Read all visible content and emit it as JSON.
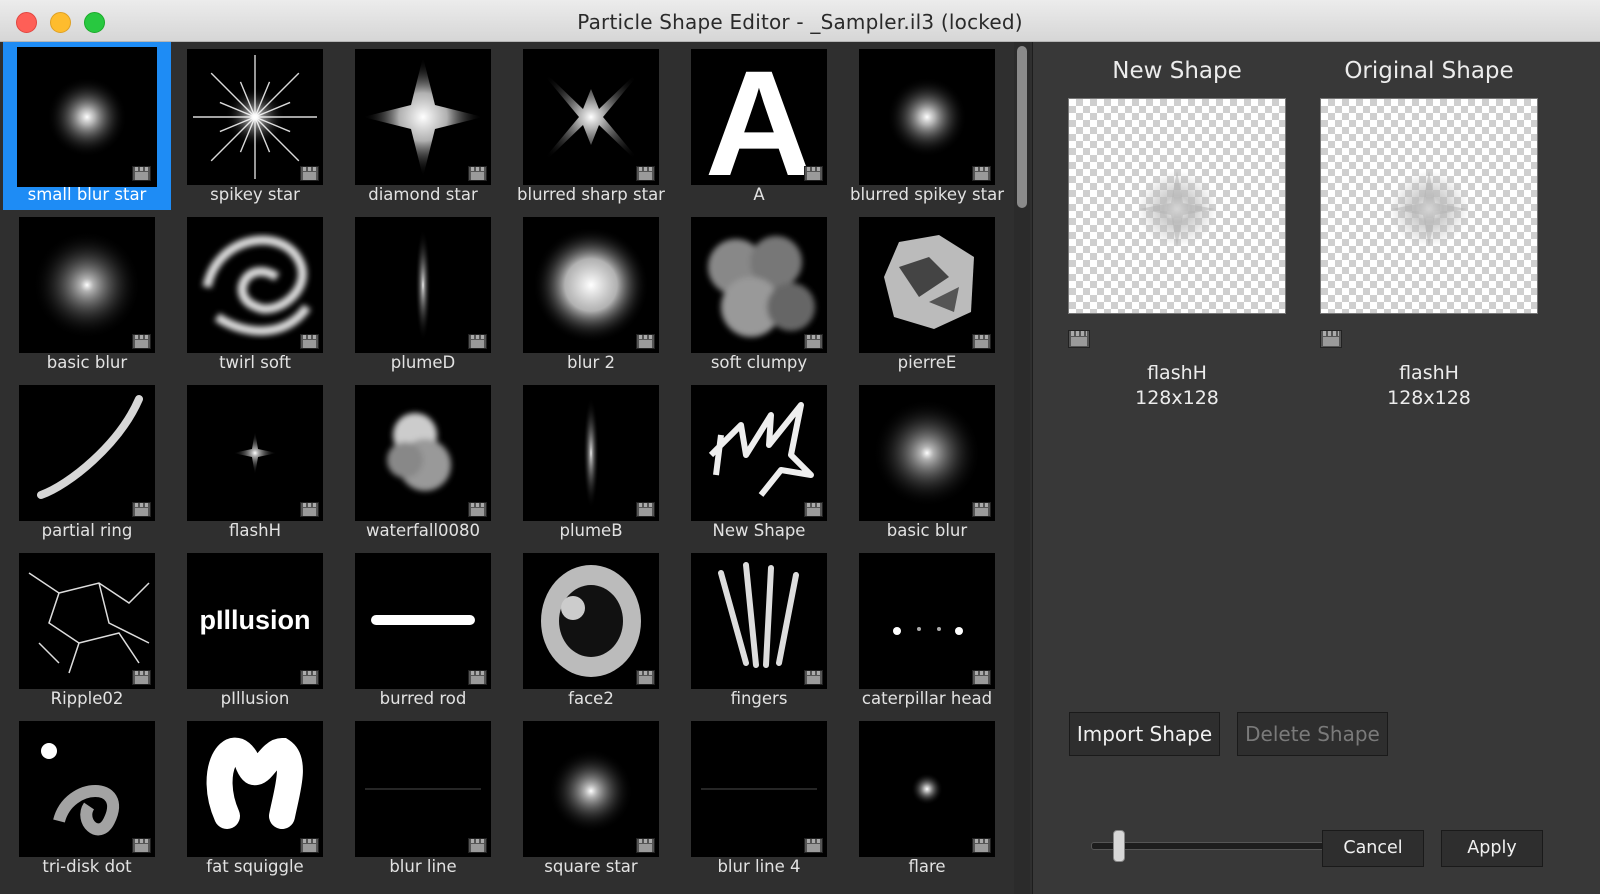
{
  "window": {
    "title": "Particle Shape Editor - _Sampler.il3 (locked)"
  },
  "shapes": [
    {
      "name": "small blur star",
      "art": "star-small"
    },
    {
      "name": "spikey star",
      "art": "star-spikey"
    },
    {
      "name": "diamond star",
      "art": "star-diamond"
    },
    {
      "name": "blurred sharp star",
      "art": "star-sharp"
    },
    {
      "name": "A",
      "art": "letter-a"
    },
    {
      "name": "blurred spikey star",
      "art": "star-small"
    },
    {
      "name": "basic blur",
      "art": "blur"
    },
    {
      "name": "twirl soft",
      "art": "twirl"
    },
    {
      "name": "plumeD",
      "art": "plume"
    },
    {
      "name": "blur 2",
      "art": "blur-big"
    },
    {
      "name": "soft clumpy",
      "art": "clumpy"
    },
    {
      "name": "pierreE",
      "art": "rock"
    },
    {
      "name": "partial ring",
      "art": "ring"
    },
    {
      "name": "flashH",
      "art": "flash"
    },
    {
      "name": "waterfall0080",
      "art": "cloud"
    },
    {
      "name": "plumeB",
      "art": "plume"
    },
    {
      "name": "New Shape",
      "art": "lightning"
    },
    {
      "name": "basic blur",
      "art": "blur"
    },
    {
      "name": "Ripple02",
      "art": "cracks"
    },
    {
      "name": "pIllusion",
      "art": "word"
    },
    {
      "name": "burred rod",
      "art": "rod"
    },
    {
      "name": "face2",
      "art": "face"
    },
    {
      "name": "fingers",
      "art": "fingers"
    },
    {
      "name": "caterpillar head",
      "art": "dots"
    },
    {
      "name": "tri-disk dot",
      "art": "swirl"
    },
    {
      "name": "fat squiggle",
      "art": "squiggle"
    },
    {
      "name": "blur line",
      "art": "line"
    },
    {
      "name": "square star",
      "art": "blur-square"
    },
    {
      "name": "blur line 4",
      "art": "line"
    },
    {
      "name": "flare",
      "art": "flare"
    }
  ],
  "thumb_text": {
    "letter": "A",
    "word": "pIllusion"
  },
  "selected_index": 0,
  "preview": {
    "new": {
      "title": "New Shape",
      "name": "flashH",
      "size": "128x128"
    },
    "original": {
      "title": "Original Shape",
      "name": "flashH",
      "size": "128x128"
    }
  },
  "buttons": {
    "import": "Import Shape",
    "delete": "Delete Shape",
    "cancel": "Cancel",
    "apply": "Apply"
  },
  "colors": {
    "selection": "#1e8cf5",
    "panel": "#2f2f2f",
    "detail_panel": "#383838"
  }
}
